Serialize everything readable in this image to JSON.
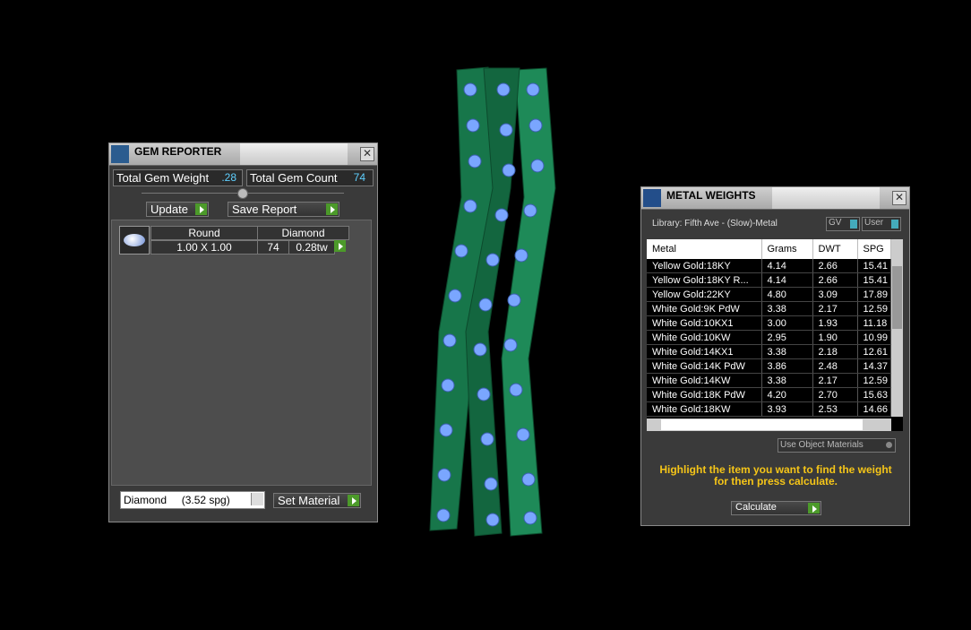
{
  "gem_reporter": {
    "title": "GEM REPORTER",
    "close": "✕",
    "total_weight_label": "Total Gem Weight",
    "total_weight_value": ".28",
    "total_count_label": "Total Gem Count",
    "total_count_value": "74",
    "update_label": "Update",
    "save_report_label": "Save Report",
    "row": {
      "shape_header": "Round",
      "size": "1.00 X 1.00",
      "material_header": "Diamond",
      "count": "74",
      "weight": "0.28tw"
    },
    "material_select": "Diamond     (3.52 spg)",
    "set_material_label": "Set Material"
  },
  "metal_weights": {
    "title": "METAL WEIGHTS",
    "close": "✕",
    "library": "Library: Fifth Ave - (Slow)-Metal",
    "gv_label": "GV",
    "user_label": "User",
    "columns": [
      "Metal",
      "Grams",
      "DWT",
      "SPG"
    ],
    "rows": [
      [
        "Yellow Gold:18KY",
        "4.14",
        "2.66",
        "15.41"
      ],
      [
        "Yellow Gold:18KY R...",
        "4.14",
        "2.66",
        "15.41"
      ],
      [
        "Yellow Gold:22KY",
        "4.80",
        "3.09",
        "17.89"
      ],
      [
        "White Gold:9K PdW",
        "3.38",
        "2.17",
        "12.59"
      ],
      [
        "White Gold:10KX1",
        "3.00",
        "1.93",
        "11.18"
      ],
      [
        "White Gold:10KW",
        "2.95",
        "1.90",
        "10.99"
      ],
      [
        "White Gold:14KX1",
        "3.38",
        "2.18",
        "12.61"
      ],
      [
        "White Gold:14K PdW",
        "3.86",
        "2.48",
        "14.37"
      ],
      [
        "White Gold:14KW",
        "3.38",
        "2.17",
        "12.59"
      ],
      [
        "White Gold:18K PdW",
        "4.20",
        "2.70",
        "15.63"
      ],
      [
        "White Gold:18KW",
        "3.93",
        "2.53",
        "14.66"
      ]
    ],
    "use_object_materials": "Use Object Materials",
    "hint": "Highlight the item you want to find the weight for then press calculate.",
    "calculate_label": "Calculate"
  }
}
